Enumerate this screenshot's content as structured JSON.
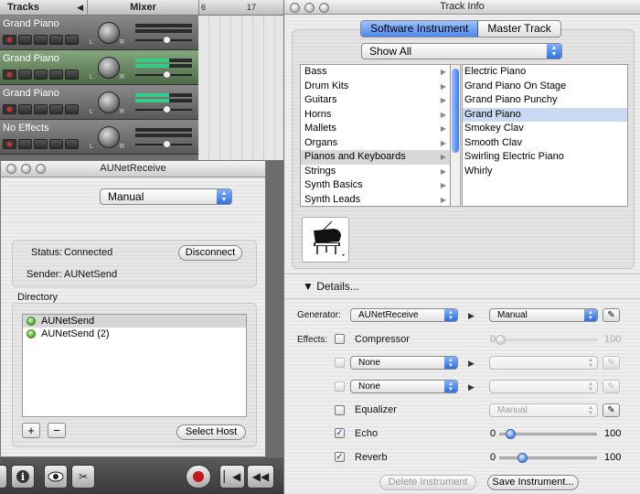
{
  "colors": {
    "selection_blue": "#c9daf2",
    "accent_blue": "#4d89ec",
    "track_green": "#5f8a58"
  },
  "garageband": {
    "tracks_header": "Tracks",
    "mixer_header": "Mixer",
    "ruler_marks": [
      "6",
      "17"
    ],
    "tracks": [
      {
        "name": "Grand Piano",
        "volume": 0.55,
        "selected": false
      },
      {
        "name": "Grand Piano",
        "volume": 0.55,
        "selected": true
      },
      {
        "name": "Grand Piano",
        "volume": 0.55,
        "selected": false
      },
      {
        "name": "No Effects",
        "volume": 0.55,
        "selected": false
      }
    ],
    "pan_left": "L",
    "pan_right": "R",
    "bottom_icons": [
      "add-track-icon",
      "info-icon",
      "eye-icon",
      "scissors-icon",
      "record-icon",
      "rewind-to-start-icon",
      "rewind-icon"
    ]
  },
  "aunetreceive": {
    "title": "AUNetReceive",
    "mode_value": "Manual",
    "status_label": "Status:",
    "status_value": "Connected",
    "disconnect_label": "Disconnect",
    "sender_label": "Sender:",
    "sender_value": "AUNetSend",
    "directory_label": "Directory",
    "directory_items": [
      "AUNetSend",
      "AUNetSend (2)"
    ],
    "add_label": "+",
    "remove_label": "−",
    "select_host_label": "Select Host"
  },
  "track_info": {
    "title": "Track Info",
    "tabs": [
      "Software Instrument",
      "Master Track"
    ],
    "filter_value": "Show All",
    "categories": [
      "Bass",
      "Drum Kits",
      "Guitars",
      "Horns",
      "Mallets",
      "Organs",
      "Pianos and Keyboards",
      "Strings",
      "Synth Basics",
      "Synth Leads"
    ],
    "selected_category": "Pianos and Keyboards",
    "instruments": [
      "Electric Piano",
      "Grand Piano On Stage",
      "Grand Piano Punchy",
      "Grand Piano",
      "Smokey Clav",
      "Smooth Clav",
      "Swirling Electric Piano",
      "Whirly"
    ],
    "selected_instrument": "Grand Piano",
    "details_label": "Details...",
    "generator_label": "Generator:",
    "generator_value": "AUNetReceive",
    "generator_preset": "Manual",
    "effects_label": "Effects:",
    "effects": [
      {
        "name": "Compressor",
        "checked": false,
        "enabled": false,
        "value": 0,
        "min_label": "0",
        "max_label": "100"
      },
      {
        "plugin": "None",
        "checked": false
      },
      {
        "plugin": "None",
        "checked": false
      },
      {
        "name": "Equalizer",
        "checked": false,
        "preset": "Manual"
      },
      {
        "name": "Echo",
        "checked": true,
        "value": 10,
        "min_label": "0",
        "max_label": "100"
      },
      {
        "name": "Reverb",
        "checked": true,
        "value": 22,
        "min_label": "0",
        "max_label": "100"
      }
    ],
    "delete_instrument_label": "Delete Instrument",
    "save_instrument_label": "Save Instrument..."
  }
}
